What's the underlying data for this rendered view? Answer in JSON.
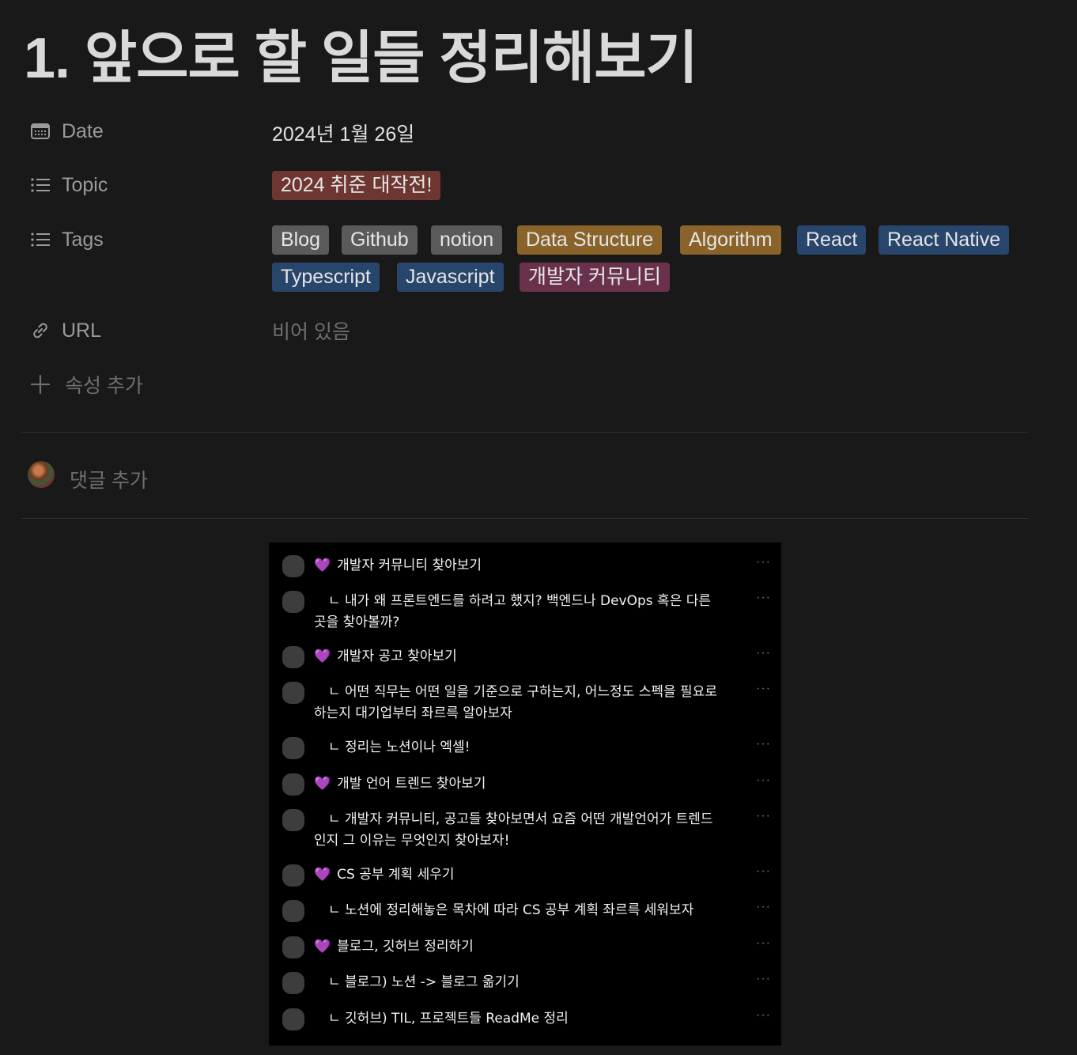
{
  "page": {
    "title": "1. 앞으로 할 일들 정리해보기"
  },
  "properties": {
    "date": {
      "label": "Date",
      "value": "2024년 1월 26일",
      "icon": "calendar-icon"
    },
    "topic": {
      "label": "Topic",
      "value": "2024 취준 대작전!",
      "color": "#6e3630",
      "icon": "list-icon"
    },
    "tags": {
      "label": "Tags",
      "icon": "list-icon",
      "items": [
        {
          "label": "Blog",
          "color": "#5a5a5a"
        },
        {
          "label": "Github",
          "color": "#5a5a5a"
        },
        {
          "label": "notion",
          "color": "#5a5a5a"
        },
        {
          "label": "Data Structure",
          "color": "#89632a"
        },
        {
          "label": "Algorithm",
          "color": "#89632a"
        },
        {
          "label": "React",
          "color": "#28456c"
        },
        {
          "label": "React Native",
          "color": "#28456c"
        },
        {
          "label": "Typescript",
          "color": "#28456c"
        },
        {
          "label": "Javascript",
          "color": "#28456c"
        },
        {
          "label": "개발자 커뮤니티",
          "color": "#69314c"
        }
      ]
    },
    "url": {
      "label": "URL",
      "value": "비어 있음",
      "icon": "link-icon"
    },
    "add_property": {
      "label": "속성 추가",
      "icon": "plus-icon"
    }
  },
  "comments": {
    "placeholder": "댓글 추가"
  },
  "embedded_screenshot": {
    "rows": [
      {
        "heart": true,
        "text": "개발자 커뮤니티 찾아보기"
      },
      {
        "heart": false,
        "text": "ㄴ 내가 왜 프론트엔드를 하려고 했지? 백엔드나 DevOps 혹은 다른 곳을 찾아볼까?"
      },
      {
        "heart": true,
        "text": "개발자 공고 찾아보기"
      },
      {
        "heart": false,
        "text": "ㄴ 어떤 직무는 어떤 일을 기준으로 구하는지, 어느정도 스펙을 필요로 하는지 대기업부터 좌르륵 알아보자"
      },
      {
        "heart": false,
        "text": "ㄴ 정리는 노션이나 엑셀!"
      },
      {
        "heart": true,
        "text": "개발 언어 트렌드 찾아보기"
      },
      {
        "heart": false,
        "text": "ㄴ 개발자 커뮤니티, 공고들 찾아보면서 요즘 어떤 개발언어가 트렌드인지 그 이유는 무엇인지 찾아보자!"
      },
      {
        "heart": true,
        "text": "CS 공부 계획 세우기"
      },
      {
        "heart": false,
        "text": "ㄴ 노션에 정리해놓은 목차에 따라 CS 공부 계획 좌르륵 세워보자"
      },
      {
        "heart": true,
        "text": "블로그, 깃허브 정리하기"
      },
      {
        "heart": false,
        "text": "ㄴ 블로그) 노션 -> 블로그 옮기기"
      },
      {
        "heart": false,
        "text": "ㄴ 깃허브) TIL, 프로젝트들 ReadMe 정리"
      }
    ],
    "heart_glyph": "💜",
    "more_glyph": "···"
  }
}
